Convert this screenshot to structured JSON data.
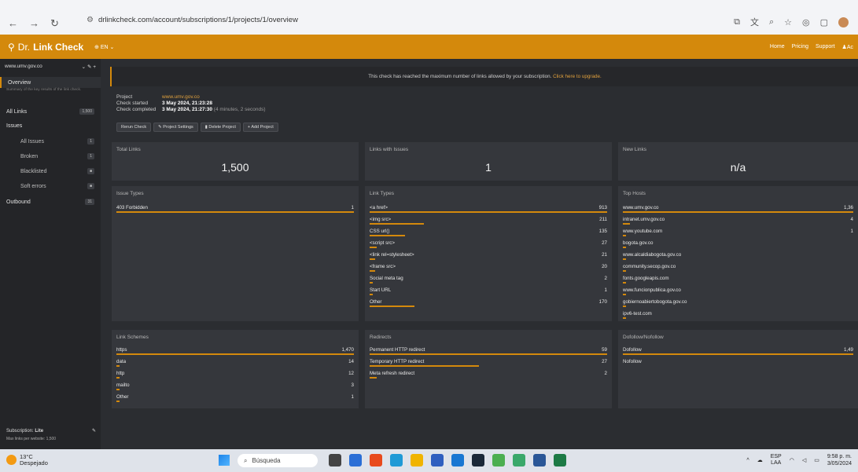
{
  "browser": {
    "url": "drlinkcheck.com/account/subscriptions/1/projects/1/overview"
  },
  "header": {
    "logo_dr": "Dr.",
    "logo_lc": "Link Check",
    "lang": "EN",
    "nav": [
      "Home",
      "Pricing",
      "Support",
      "Ac"
    ]
  },
  "sidebar": {
    "site": "www.umv.gov.co",
    "overview": "Overview",
    "overview_desc": "Summary of the key results of the link check.",
    "all_links": "All Links",
    "all_links_count": "1,500",
    "issues": "Issues",
    "all_issues": "All Issues",
    "all_issues_count": "1",
    "broken": "Broken",
    "broken_count": "1",
    "blacklisted": "Blacklisted",
    "soft_errors": "Soft errors",
    "outbound": "Outbound",
    "outbound_count": "31",
    "subscription": "Subscription:",
    "subscription_plan": "Lite",
    "max_links": "Max links per website: 1,500"
  },
  "banner": {
    "text": "This check has reached the maximum number of links allowed by your subscription.",
    "link": "Click here to upgrade."
  },
  "project": {
    "project_label": "Project",
    "project_url": "www.umv.gov.co",
    "started_label": "Check started",
    "started": "3 May 2024, 21:23:28",
    "completed_label": "Check completed",
    "completed": "3 May 2024, 21:27:30",
    "duration": "(4 minutes, 2 seconds)"
  },
  "buttons": [
    "Rerun Check",
    "Project Settings",
    "Delete Project",
    "+ Add Project"
  ],
  "stats": {
    "total_title": "Total Links",
    "total": "1,500",
    "issues_title": "Links with Issues",
    "issues": "1",
    "new_title": "New Links",
    "new": "n/a"
  },
  "issue_types": {
    "title": "Issue Types",
    "rows": [
      {
        "k": "403 Forbidden",
        "v": "1",
        "pct": 100
      }
    ]
  },
  "link_types": {
    "title": "Link Types",
    "rows": [
      {
        "k": "<a href>",
        "v": "913",
        "pct": 100
      },
      {
        "k": "<img src>",
        "v": "211",
        "pct": 23
      },
      {
        "k": "CSS url()",
        "v": "135",
        "pct": 15
      },
      {
        "k": "<script src>",
        "v": "27",
        "pct": 3
      },
      {
        "k": "<link rel=stylesheet>",
        "v": "21",
        "pct": 2.3
      },
      {
        "k": "<frame src>",
        "v": "20",
        "pct": 2.2
      },
      {
        "k": "Social meta tag",
        "v": "2",
        "pct": 0.4
      },
      {
        "k": "Start URL",
        "v": "1",
        "pct": 0.2
      },
      {
        "k": "Other",
        "v": "170",
        "pct": 19
      }
    ]
  },
  "top_hosts": {
    "title": "Top Hosts",
    "rows": [
      {
        "k": "www.umv.gov.co",
        "v": "1,36",
        "pct": 100
      },
      {
        "k": "intranet.umv.gov.co",
        "v": "4",
        "pct": 3
      },
      {
        "k": "www.youtube.com",
        "v": "1",
        "pct": 1
      },
      {
        "k": "bogota.gov.co",
        "v": "",
        "pct": 0.5
      },
      {
        "k": "www.alcaldiabogota.gov.co",
        "v": "",
        "pct": 0.5
      },
      {
        "k": "community.secop.gov.co",
        "v": "",
        "pct": 0.5
      },
      {
        "k": "fonts.googleapis.com",
        "v": "",
        "pct": 0.5
      },
      {
        "k": "www.funcionpublica.gov.co",
        "v": "",
        "pct": 0.5
      },
      {
        "k": "gobiernoabiertobogota.gov.co",
        "v": "",
        "pct": 0.5
      },
      {
        "k": "ipv6-test.com",
        "v": "",
        "pct": 0.3
      }
    ]
  },
  "link_schemes": {
    "title": "Link Schemes",
    "rows": [
      {
        "k": "https",
        "v": "1,470",
        "pct": 100
      },
      {
        "k": "data",
        "v": "14",
        "pct": 1
      },
      {
        "k": "http",
        "v": "12",
        "pct": 0.8
      },
      {
        "k": "mailto",
        "v": "3",
        "pct": 0.3
      },
      {
        "k": "Other",
        "v": "1",
        "pct": 0.2
      }
    ]
  },
  "redirects": {
    "title": "Redirects",
    "rows": [
      {
        "k": "Permanent HTTP redirect",
        "v": "59",
        "pct": 100
      },
      {
        "k": "Temporary HTTP redirect",
        "v": "27",
        "pct": 46
      },
      {
        "k": "Meta refresh redirect",
        "v": "2",
        "pct": 3
      }
    ]
  },
  "dofollow": {
    "title": "Dofollow/Nofollow",
    "rows": [
      {
        "k": "Dofollow",
        "v": "1,49",
        "pct": 100
      },
      {
        "k": "Nofollow",
        "v": "",
        "pct": 0
      }
    ]
  },
  "taskbar": {
    "temp": "13°C",
    "weather": "Despejado",
    "search": "Búsqueda",
    "lang1": "ESP",
    "lang2": "LAA",
    "time": "9:58 p. m.",
    "date": "3/05/2024"
  },
  "colors": {
    "accent": "#d4890c",
    "panel": "#35373c",
    "background": "#2b2d31"
  }
}
